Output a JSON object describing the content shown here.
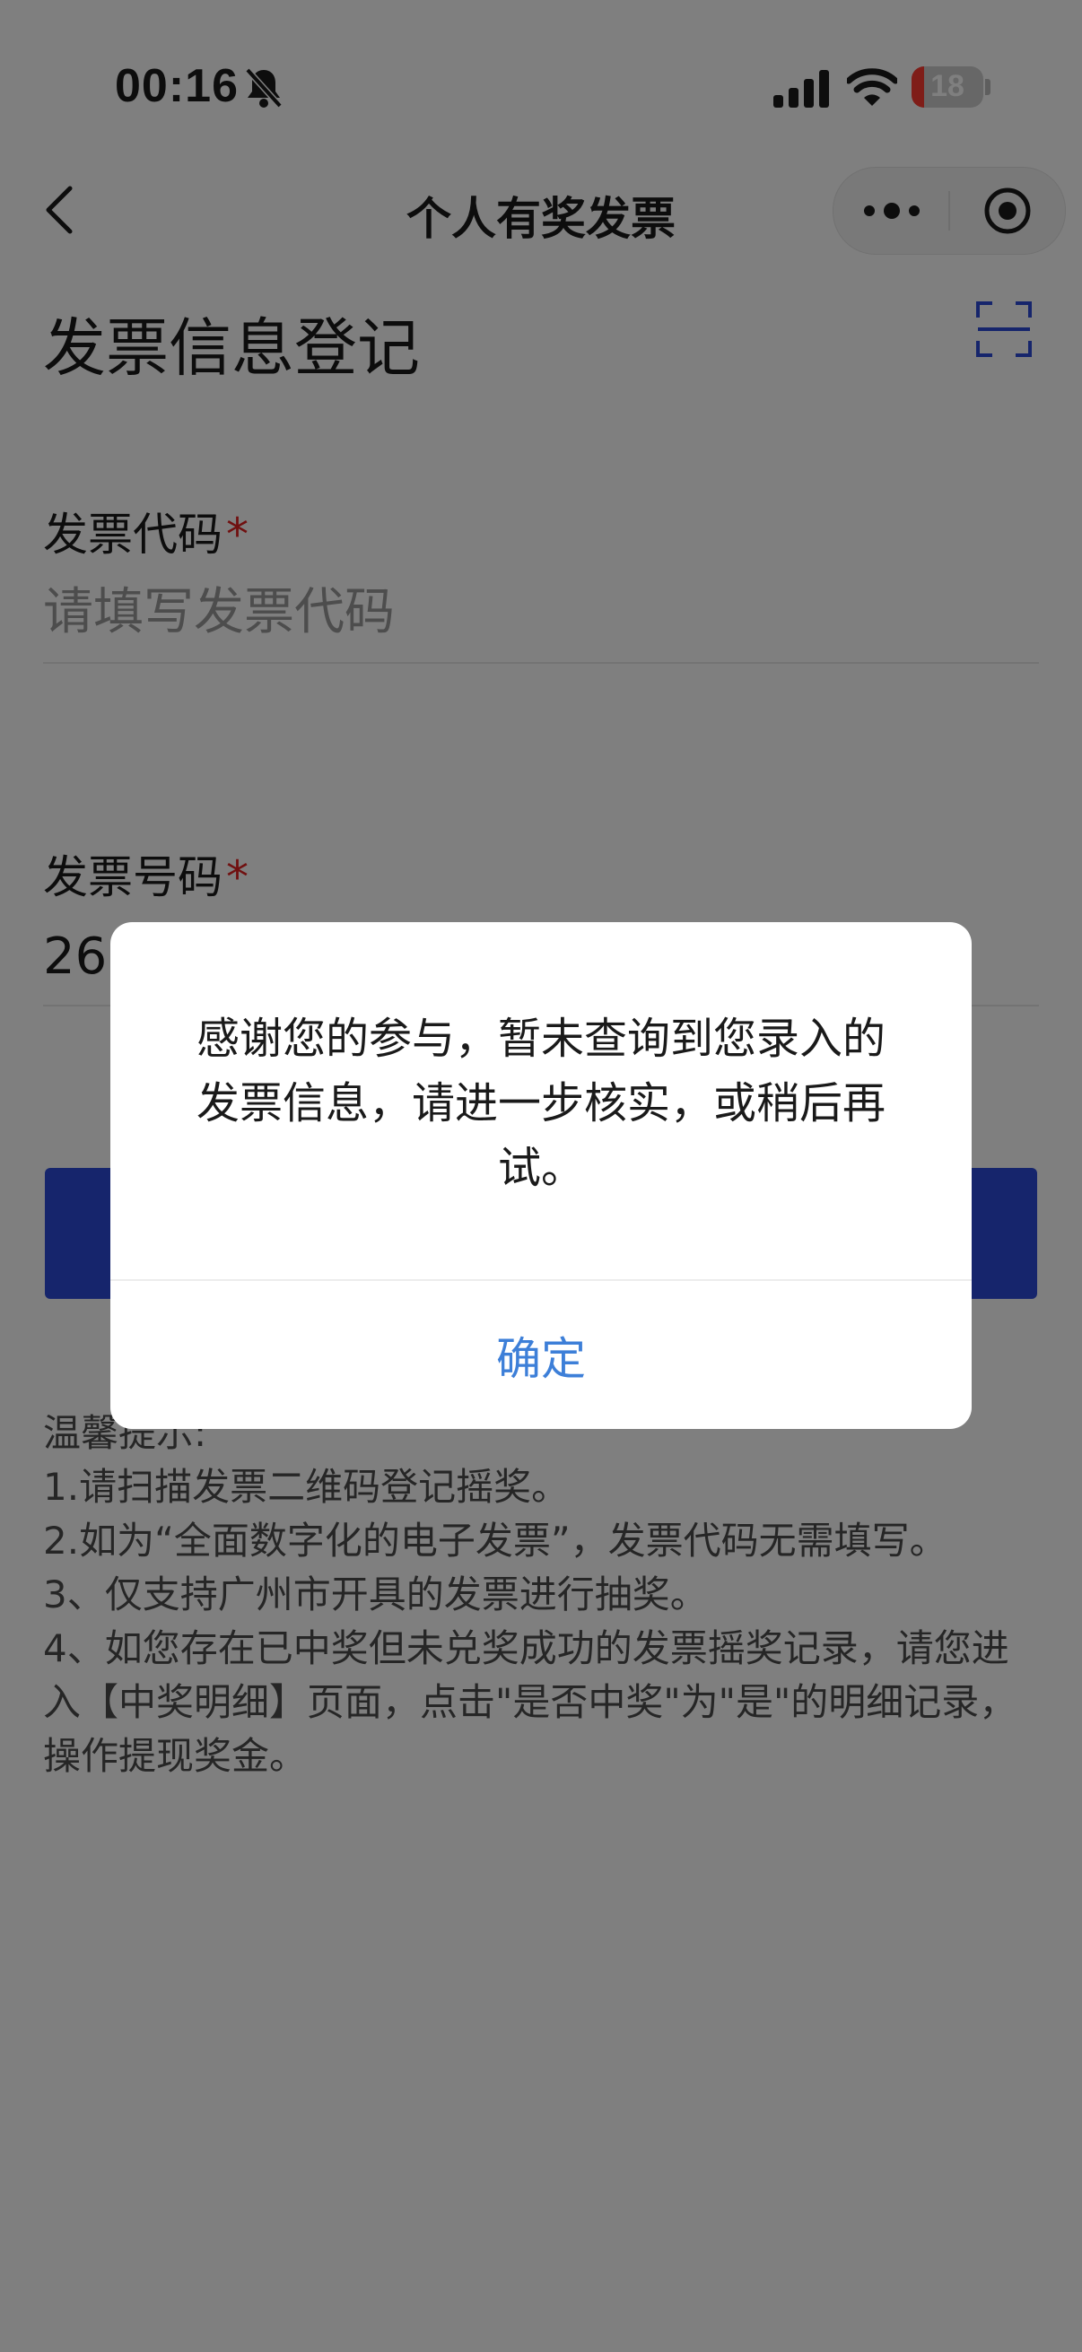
{
  "status_bar": {
    "time": "00:16",
    "battery_level": "18",
    "battery_fraction": 0.18,
    "icons": [
      "bell-off-icon",
      "signal-icon",
      "wifi-icon",
      "battery-icon"
    ]
  },
  "nav": {
    "title": "个人有奖发票",
    "icons": [
      "back-icon",
      "more-icon",
      "target-icon"
    ]
  },
  "page": {
    "title": "发票信息登记",
    "scan_icon": "scan-icon"
  },
  "form": {
    "invoice_code": {
      "label": "发票代码",
      "required_mark": "*",
      "placeholder": "请填写发票代码",
      "value": ""
    },
    "invoice_number": {
      "label": "发票号码",
      "required_mark": "*",
      "value": "26"
    }
  },
  "tips": {
    "lines": [
      "温馨提示:",
      "1.请扫描发票二维码登记摇奖。",
      "2.如为“全面数字化的电子发票”，发票代码无需填写。",
      "3、仅支持广州市开具的发票进行抽奖。",
      "4、如您存在已中奖但未兑奖成功的发票摇奖记录，请您进入【中奖明细】页面，点击\"是否中奖\"为\"是\"的明细记录，操作提现奖金。"
    ]
  },
  "dialog": {
    "message": "感谢您的参与，暂未查询到您录入的发票信息，请进一步核实，或稍后再试。",
    "confirm_label": "确定"
  },
  "colors": {
    "accent": "#2c4bd8",
    "link": "#3d7fd8",
    "required": "#e02020",
    "overlay": "rgba(0,0,0,0.5)",
    "battery_low": "#ff3b30"
  }
}
